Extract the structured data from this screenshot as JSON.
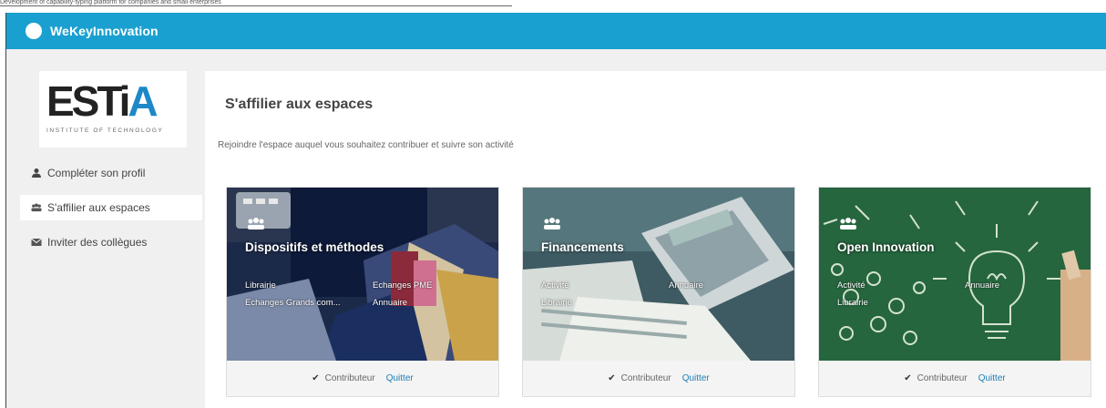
{
  "app": {
    "name": "WeKeyInnovation",
    "header_color": "#1aa0d0"
  },
  "top_line_text": "Development of capability-typing platform for companies and small enterprises",
  "logo": {
    "word_left": "EST",
    "word_i": "i",
    "word_a": "A",
    "subtitle": "INSTITUTE OF TECHNOLOGY"
  },
  "sidebar": {
    "items": [
      {
        "label": "Compléter son profil",
        "icon": "user-icon"
      },
      {
        "label": "S'affilier aux espaces",
        "icon": "group-icon",
        "active": true
      },
      {
        "label": "Inviter des collègues",
        "icon": "envelope-icon"
      }
    ]
  },
  "main": {
    "title": "S'affilier aux espaces",
    "subtitle": "Rejoindre l'espace auquel vous souhaitez contribuer et suivre son activité"
  },
  "cards": [
    {
      "title": "Dispositifs et méthodes",
      "links": [
        "Librairie",
        "Echanges PME",
        "Echanges Grands com...",
        "Annuaire"
      ],
      "status": "Contributeur",
      "action": "Quitter"
    },
    {
      "title": "Financements",
      "links": [
        "Activité",
        "Annuaire",
        "Librairie"
      ],
      "status": "Contributeur",
      "action": "Quitter"
    },
    {
      "title": "Open Innovation",
      "links": [
        "Activité",
        "Annuaire",
        "Librairie"
      ],
      "status": "Contributeur",
      "action": "Quitter"
    }
  ]
}
